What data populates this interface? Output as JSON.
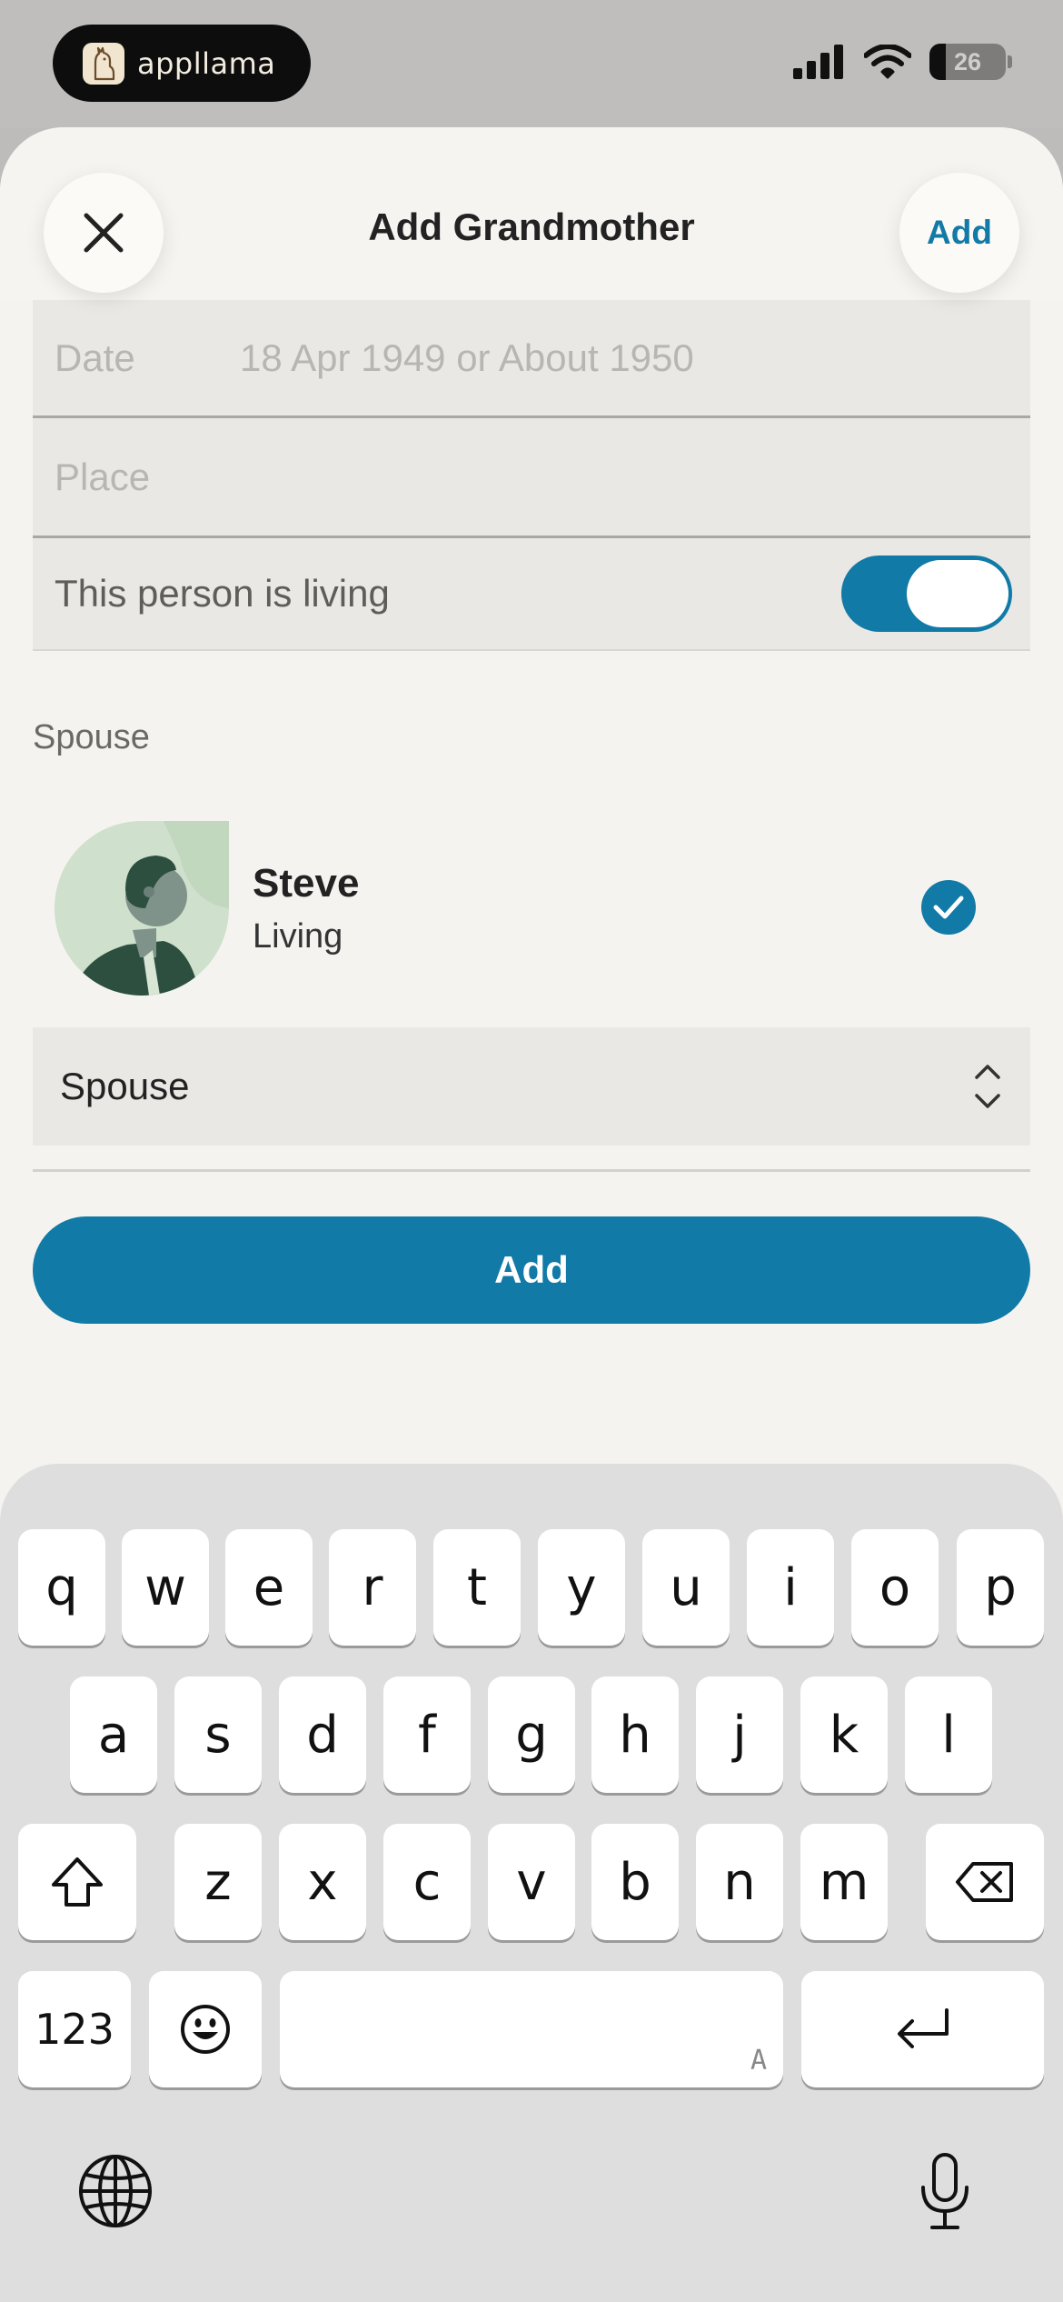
{
  "status_bar": {
    "app_pill_label": "appllama",
    "battery_level": "26"
  },
  "header": {
    "title": "Add Grandmother",
    "add_label": "Add"
  },
  "form": {
    "date_label": "Date",
    "date_placeholder": "18 Apr 1949 or About 1950",
    "place_placeholder": "Place",
    "living_label": "This person is living",
    "living_on": true
  },
  "spouse_section": {
    "label": "Spouse",
    "person": {
      "name": "Steve",
      "status": "Living",
      "selected": true
    },
    "relation_value": "Spouse"
  },
  "primary_button": {
    "label": "Add"
  },
  "keyboard": {
    "row1": [
      "q",
      "w",
      "e",
      "r",
      "t",
      "y",
      "u",
      "i",
      "o",
      "p"
    ],
    "row2": [
      "a",
      "s",
      "d",
      "f",
      "g",
      "h",
      "j",
      "k",
      "l"
    ],
    "row3": [
      "z",
      "x",
      "c",
      "v",
      "b",
      "n",
      "m"
    ],
    "numbers_label": "123",
    "space_hint": "A"
  },
  "colors": {
    "accent": "#127aa6",
    "sheet_bg": "#f4f3f0",
    "field_bg": "#e9e8e4",
    "keyboard_bg": "#dededf"
  }
}
